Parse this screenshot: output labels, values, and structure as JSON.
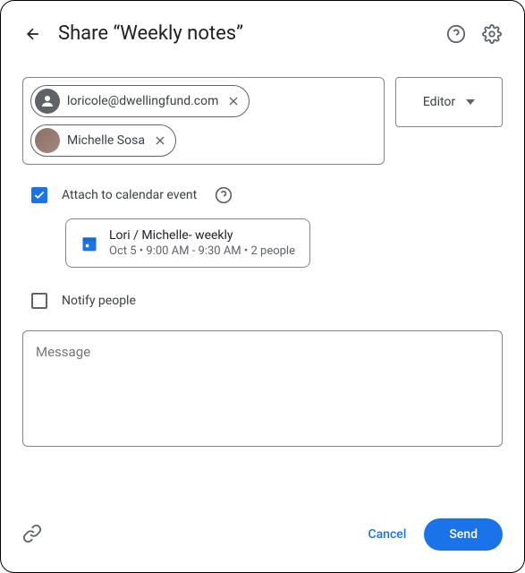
{
  "header": {
    "title": "Share “Weekly notes”"
  },
  "recipients": {
    "chips": [
      {
        "label": "loricole@dwellingfund.com",
        "avatar_type": "default"
      },
      {
        "label": "Michelle Sosa",
        "avatar_type": "photo"
      }
    ],
    "role": "Editor"
  },
  "attach_event": {
    "checkbox_label": "Attach to calendar event",
    "checked": true,
    "event": {
      "title": "Lori / Michelle- weekly",
      "details": "Oct 5 • 9:00 AM - 9:30 AM • 2 people"
    }
  },
  "notify": {
    "label": "Notify people",
    "checked": false
  },
  "message": {
    "placeholder": "Message",
    "value": ""
  },
  "actions": {
    "cancel": "Cancel",
    "send": "Send"
  }
}
